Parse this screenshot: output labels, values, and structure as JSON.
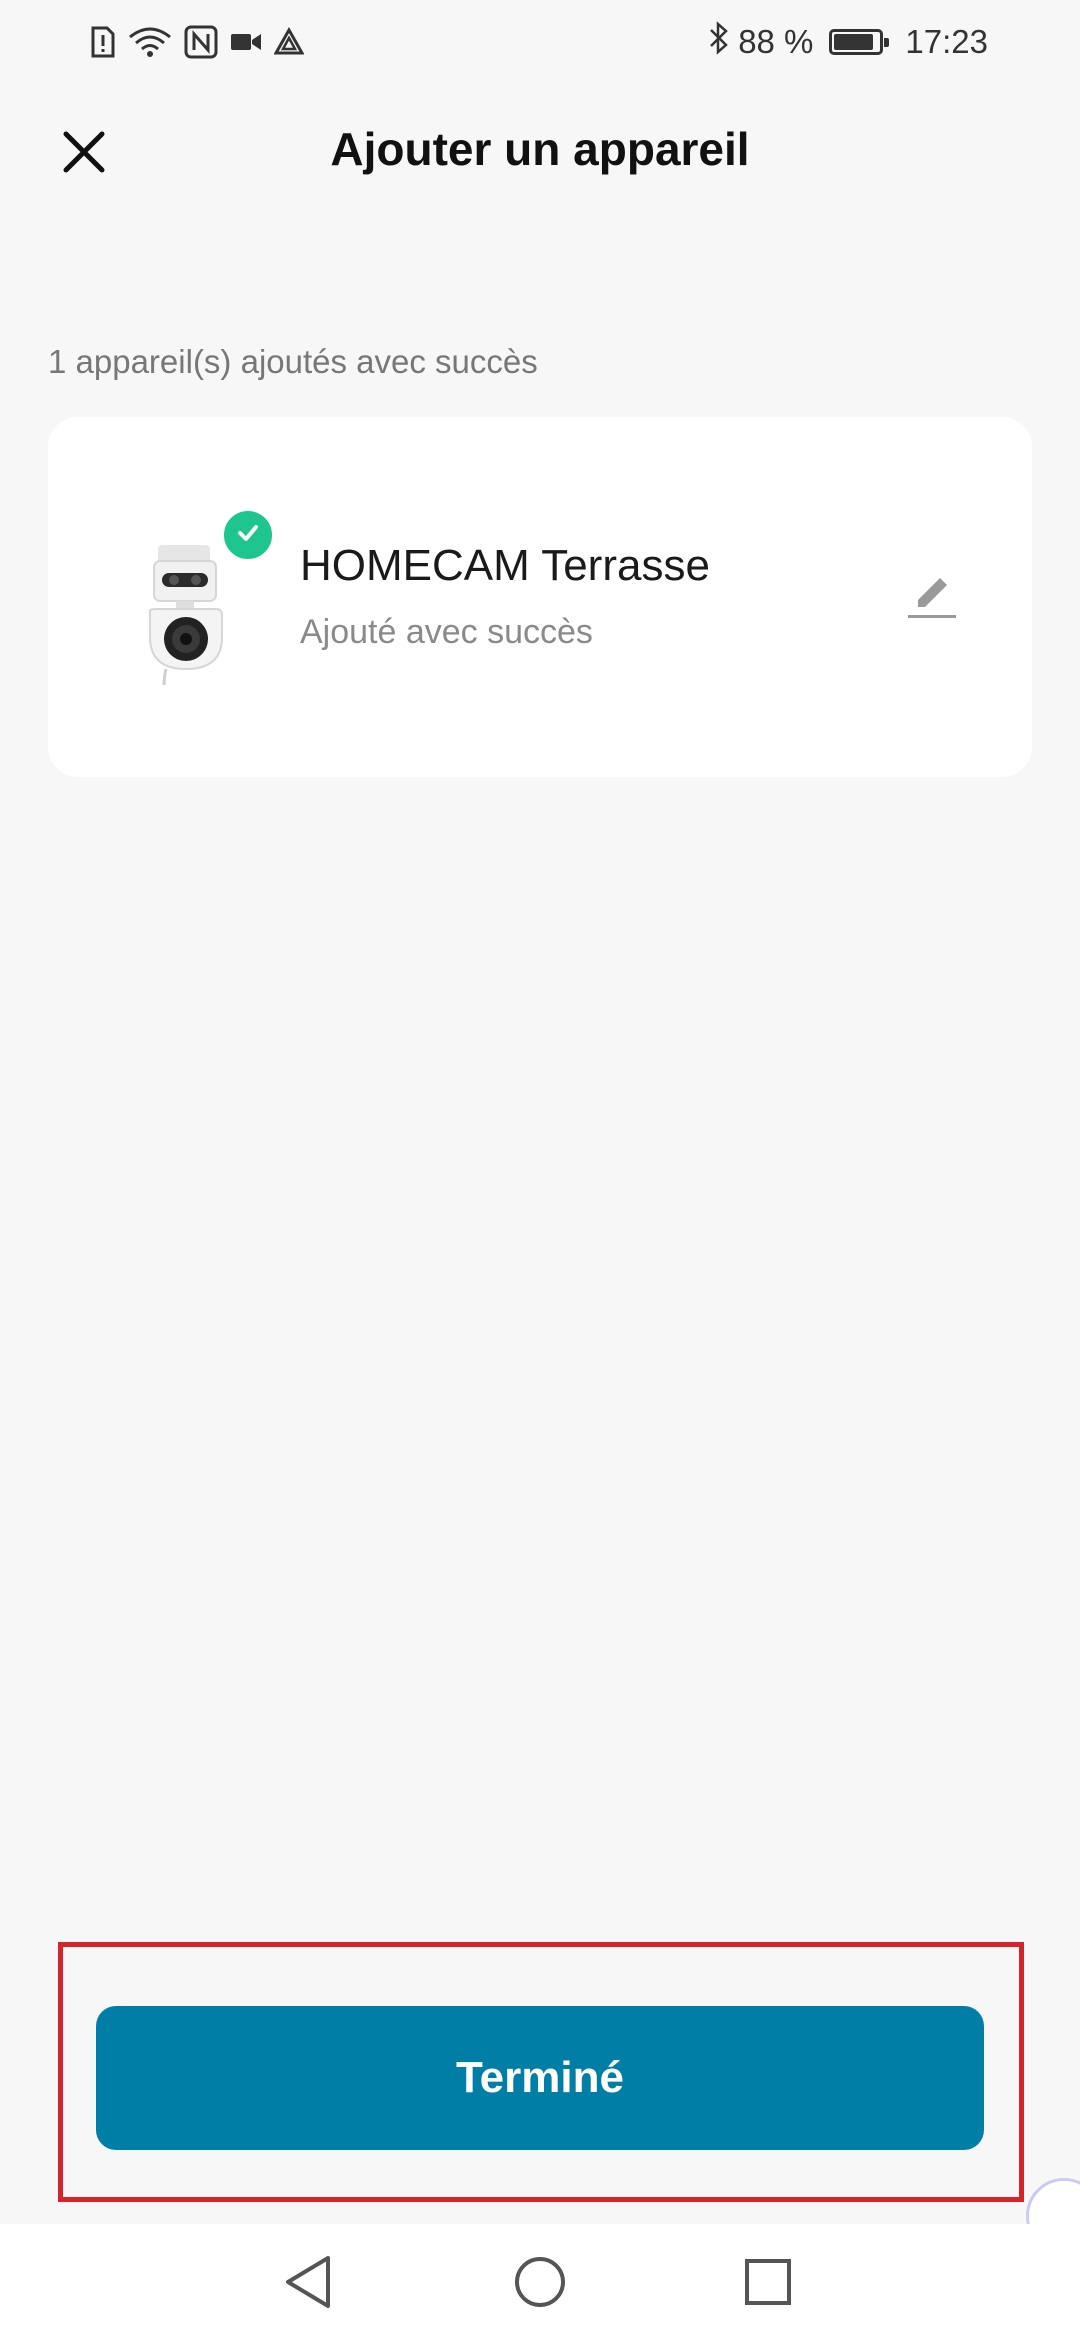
{
  "status_bar": {
    "battery_percent": "88 %",
    "battery_level": 0.88,
    "time": "17:23",
    "icons_left": [
      "sim-alert-icon",
      "wifi-icon",
      "nfc-icon",
      "video-camera-icon",
      "navigation-icon"
    ],
    "icons_right": [
      "bluetooth-icon",
      "battery-icon"
    ]
  },
  "header": {
    "title": "Ajouter un appareil",
    "close_icon": "close-icon"
  },
  "summary": {
    "text": "1 appareil(s) ajoutés avec succès"
  },
  "device": {
    "name": "HOMECAM Terrasse",
    "status": "Ajouté avec succès",
    "badge_icon": "check-icon",
    "edit_icon": "pencil-icon"
  },
  "footer": {
    "done_label": "Terminé"
  },
  "nav_bar": {
    "icons": [
      "back-icon",
      "home-icon",
      "recents-icon"
    ]
  },
  "colors": {
    "primary_button": "#017ea6",
    "success_badge": "#1ec58f",
    "highlight_frame": "#d7232a",
    "background": "#f7f7f7"
  }
}
